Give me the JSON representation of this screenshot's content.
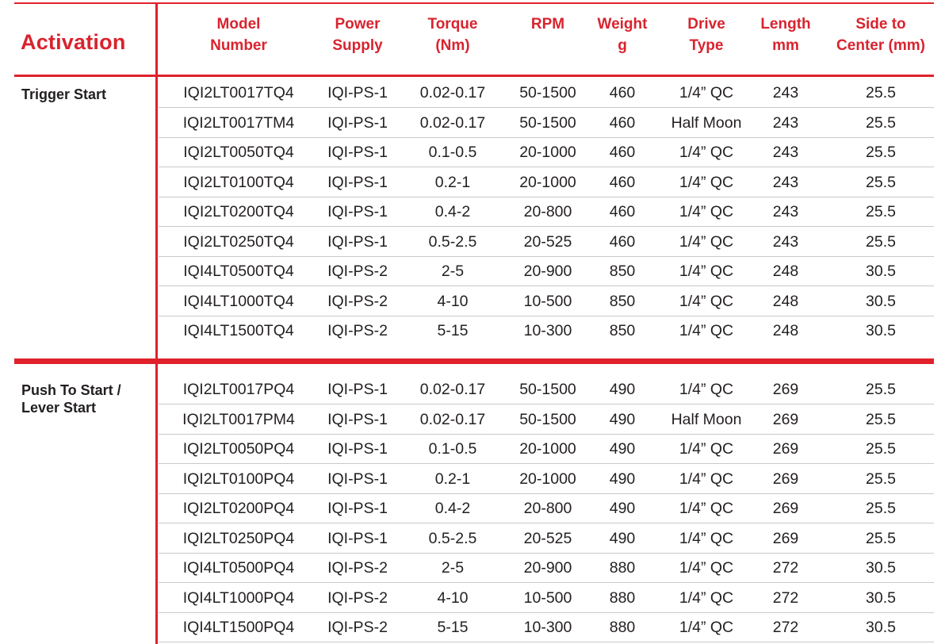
{
  "header": {
    "activation": "Activation",
    "columns": [
      {
        "line1": "Model",
        "line2": "Number"
      },
      {
        "line1": "Power",
        "line2": "Supply"
      },
      {
        "line1": "Torque",
        "line2": "(Nm)"
      },
      {
        "line1": "RPM",
        "line2": ""
      },
      {
        "line1": "Weight",
        "line2": "g"
      },
      {
        "line1": "Drive",
        "line2": "Type"
      },
      {
        "line1": "Length",
        "line2": "mm"
      },
      {
        "line1": "Side to",
        "line2": "Center (mm)"
      }
    ]
  },
  "groups": [
    {
      "label_line1": "Trigger Start",
      "label_line2": "",
      "rows": [
        [
          "IQI2LT0017TQ4",
          "IQI-PS-1",
          "0.02-0.17",
          "50-1500",
          "460",
          "1/4” QC",
          "243",
          "25.5"
        ],
        [
          "IQI2LT0017TM4",
          "IQI-PS-1",
          "0.02-0.17",
          "50-1500",
          "460",
          "Half Moon",
          "243",
          "25.5"
        ],
        [
          "IQI2LT0050TQ4",
          "IQI-PS-1",
          "0.1-0.5",
          "20-1000",
          "460",
          "1/4” QC",
          "243",
          "25.5"
        ],
        [
          "IQI2LT0100TQ4",
          "IQI-PS-1",
          "0.2-1",
          "20-1000",
          "460",
          "1/4” QC",
          "243",
          "25.5"
        ],
        [
          "IQI2LT0200TQ4",
          "IQI-PS-1",
          "0.4-2",
          "20-800",
          "460",
          "1/4” QC",
          "243",
          "25.5"
        ],
        [
          "IQI2LT0250TQ4",
          "IQI-PS-1",
          "0.5-2.5",
          "20-525",
          "460",
          "1/4” QC",
          "243",
          "25.5"
        ],
        [
          "IQI4LT0500TQ4",
          "IQI-PS-2",
          "2-5",
          "20-900",
          "850",
          "1/4” QC",
          "248",
          "30.5"
        ],
        [
          "IQI4LT1000TQ4",
          "IQI-PS-2",
          "4-10",
          "10-500",
          "850",
          "1/4” QC",
          "248",
          "30.5"
        ],
        [
          "IQI4LT1500TQ4",
          "IQI-PS-2",
          "5-15",
          "10-300",
          "850",
          "1/4” QC",
          "248",
          "30.5"
        ]
      ]
    },
    {
      "label_line1": "Push To Start /",
      "label_line2": "Lever Start",
      "rows": [
        [
          "IQI2LT0017PQ4",
          "IQI-PS-1",
          "0.02-0.17",
          "50-1500",
          "490",
          "1/4” QC",
          "269",
          "25.5"
        ],
        [
          "IQI2LT0017PM4",
          "IQI-PS-1",
          "0.02-0.17",
          "50-1500",
          "490",
          "Half Moon",
          "269",
          "25.5"
        ],
        [
          "IQI2LT0050PQ4",
          "IQI-PS-1",
          "0.1-0.5",
          "20-1000",
          "490",
          "1/4” QC",
          "269",
          "25.5"
        ],
        [
          "IQI2LT0100PQ4",
          "IQI-PS-1",
          "0.2-1",
          "20-1000",
          "490",
          "1/4” QC",
          "269",
          "25.5"
        ],
        [
          "IQI2LT0200PQ4",
          "IQI-PS-1",
          "0.4-2",
          "20-800",
          "490",
          "1/4” QC",
          "269",
          "25.5"
        ],
        [
          "IQI2LT0250PQ4",
          "IQI-PS-1",
          "0.5-2.5",
          "20-525",
          "490",
          "1/4” QC",
          "269",
          "25.5"
        ],
        [
          "IQI4LT0500PQ4",
          "IQI-PS-2",
          "2-5",
          "20-900",
          "880",
          "1/4” QC",
          "272",
          "30.5"
        ],
        [
          "IQI4LT1000PQ4",
          "IQI-PS-2",
          "4-10",
          "10-500",
          "880",
          "1/4” QC",
          "272",
          "30.5"
        ],
        [
          "IQI4LT1500PQ4",
          "IQI-PS-2",
          "5-15",
          "10-300",
          "880",
          "1/4” QC",
          "272",
          "30.5"
        ]
      ]
    }
  ]
}
